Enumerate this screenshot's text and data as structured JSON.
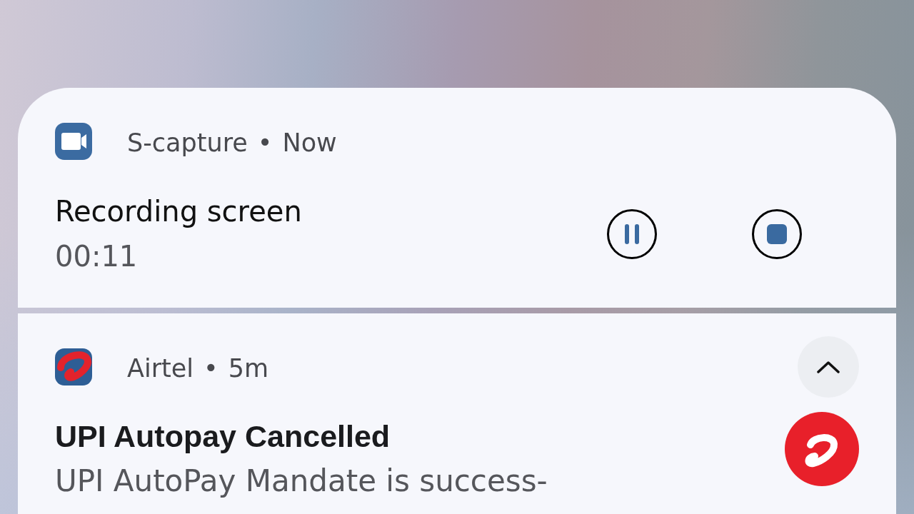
{
  "notifications": [
    {
      "kind": "ongoing",
      "app_name": "S-capture",
      "separator": "•",
      "time": "Now",
      "title": "Recording screen",
      "subtitle": "00:11",
      "actions": [
        {
          "kind": "pause"
        },
        {
          "kind": "stop"
        }
      ]
    },
    {
      "kind": "message",
      "app_name": "Airtel",
      "separator": "•",
      "time": "5m",
      "expanded": true,
      "title": "UPI Autopay Cancelled",
      "text": "UPI AutoPay Mandate is success-"
    }
  ]
}
